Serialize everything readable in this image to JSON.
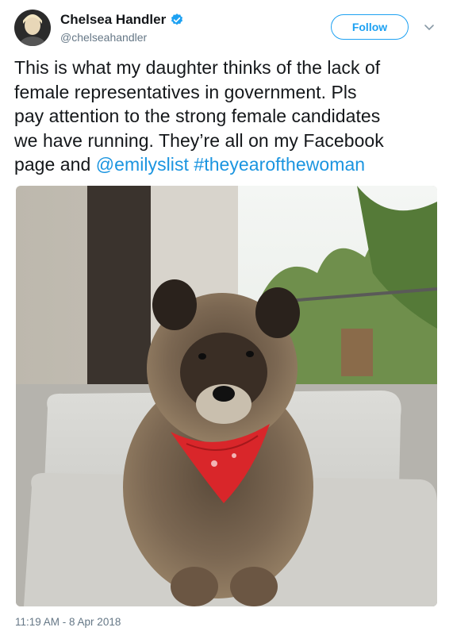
{
  "author": {
    "display_name": "Chelsea Handler",
    "handle": "@chelseahandler",
    "verified": true,
    "avatar_icon": "avatar-photo"
  },
  "actions": {
    "follow_label": "Follow",
    "caret_icon": "chevron-down-icon"
  },
  "tweet": {
    "text_lines": [
      "This is what my daughter thinks of the lack of",
      "female representatives in government. Pls",
      "pay attention to the strong female candidates",
      "we have running. They’re all on my Facebook"
    ],
    "last_line_prefix": "page and ",
    "mention": "@emilyslist",
    "hashtag": "#theyearofthewoman"
  },
  "media": {
    "type": "photo",
    "subject": "dog-photo"
  },
  "timestamp": "11:19 AM - 8 Apr 2018",
  "colors": {
    "link": "#1b95e0",
    "follow": "#1da1f2",
    "verified": "#1da1f2",
    "bandana": "#d9262a",
    "meta": "#657786"
  }
}
